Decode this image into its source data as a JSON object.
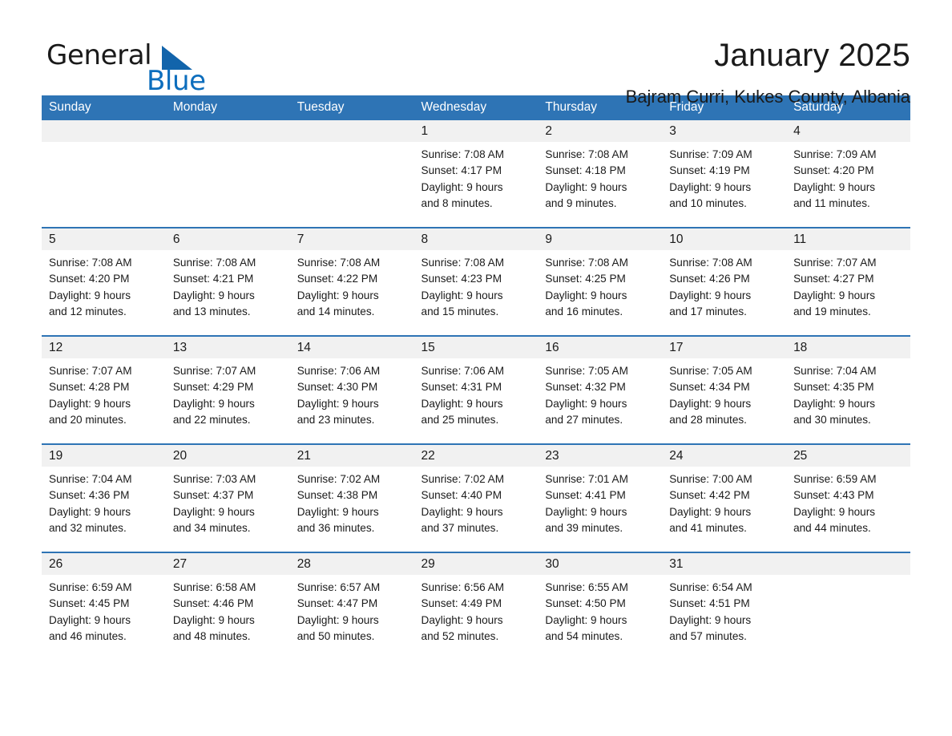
{
  "logo": {
    "word1": "General",
    "word2": "Blue",
    "triangle_color": "#1264ab",
    "word2_color": "#0d6ebd"
  },
  "header": {
    "month_title": "January 2025",
    "location": "Bajram Curri, Kukes County, Albania"
  },
  "theme": {
    "header_blue": "#2e74b5",
    "daynum_band": "#f1f1f1",
    "page_background": "#ffffff",
    "text": "#1a1a1a"
  },
  "calendar": {
    "weekday_headers": [
      "Sunday",
      "Monday",
      "Tuesday",
      "Wednesday",
      "Thursday",
      "Friday",
      "Saturday"
    ],
    "weeks": [
      [
        {
          "day": "",
          "lines": []
        },
        {
          "day": "",
          "lines": []
        },
        {
          "day": "",
          "lines": []
        },
        {
          "day": "1",
          "lines": [
            "Sunrise: 7:08 AM",
            "Sunset: 4:17 PM",
            "Daylight: 9 hours",
            "and 8 minutes."
          ]
        },
        {
          "day": "2",
          "lines": [
            "Sunrise: 7:08 AM",
            "Sunset: 4:18 PM",
            "Daylight: 9 hours",
            "and 9 minutes."
          ]
        },
        {
          "day": "3",
          "lines": [
            "Sunrise: 7:09 AM",
            "Sunset: 4:19 PM",
            "Daylight: 9 hours",
            "and 10 minutes."
          ]
        },
        {
          "day": "4",
          "lines": [
            "Sunrise: 7:09 AM",
            "Sunset: 4:20 PM",
            "Daylight: 9 hours",
            "and 11 minutes."
          ]
        }
      ],
      [
        {
          "day": "5",
          "lines": [
            "Sunrise: 7:08 AM",
            "Sunset: 4:20 PM",
            "Daylight: 9 hours",
            "and 12 minutes."
          ]
        },
        {
          "day": "6",
          "lines": [
            "Sunrise: 7:08 AM",
            "Sunset: 4:21 PM",
            "Daylight: 9 hours",
            "and 13 minutes."
          ]
        },
        {
          "day": "7",
          "lines": [
            "Sunrise: 7:08 AM",
            "Sunset: 4:22 PM",
            "Daylight: 9 hours",
            "and 14 minutes."
          ]
        },
        {
          "day": "8",
          "lines": [
            "Sunrise: 7:08 AM",
            "Sunset: 4:23 PM",
            "Daylight: 9 hours",
            "and 15 minutes."
          ]
        },
        {
          "day": "9",
          "lines": [
            "Sunrise: 7:08 AM",
            "Sunset: 4:25 PM",
            "Daylight: 9 hours",
            "and 16 minutes."
          ]
        },
        {
          "day": "10",
          "lines": [
            "Sunrise: 7:08 AM",
            "Sunset: 4:26 PM",
            "Daylight: 9 hours",
            "and 17 minutes."
          ]
        },
        {
          "day": "11",
          "lines": [
            "Sunrise: 7:07 AM",
            "Sunset: 4:27 PM",
            "Daylight: 9 hours",
            "and 19 minutes."
          ]
        }
      ],
      [
        {
          "day": "12",
          "lines": [
            "Sunrise: 7:07 AM",
            "Sunset: 4:28 PM",
            "Daylight: 9 hours",
            "and 20 minutes."
          ]
        },
        {
          "day": "13",
          "lines": [
            "Sunrise: 7:07 AM",
            "Sunset: 4:29 PM",
            "Daylight: 9 hours",
            "and 22 minutes."
          ]
        },
        {
          "day": "14",
          "lines": [
            "Sunrise: 7:06 AM",
            "Sunset: 4:30 PM",
            "Daylight: 9 hours",
            "and 23 minutes."
          ]
        },
        {
          "day": "15",
          "lines": [
            "Sunrise: 7:06 AM",
            "Sunset: 4:31 PM",
            "Daylight: 9 hours",
            "and 25 minutes."
          ]
        },
        {
          "day": "16",
          "lines": [
            "Sunrise: 7:05 AM",
            "Sunset: 4:32 PM",
            "Daylight: 9 hours",
            "and 27 minutes."
          ]
        },
        {
          "day": "17",
          "lines": [
            "Sunrise: 7:05 AM",
            "Sunset: 4:34 PM",
            "Daylight: 9 hours",
            "and 28 minutes."
          ]
        },
        {
          "day": "18",
          "lines": [
            "Sunrise: 7:04 AM",
            "Sunset: 4:35 PM",
            "Daylight: 9 hours",
            "and 30 minutes."
          ]
        }
      ],
      [
        {
          "day": "19",
          "lines": [
            "Sunrise: 7:04 AM",
            "Sunset: 4:36 PM",
            "Daylight: 9 hours",
            "and 32 minutes."
          ]
        },
        {
          "day": "20",
          "lines": [
            "Sunrise: 7:03 AM",
            "Sunset: 4:37 PM",
            "Daylight: 9 hours",
            "and 34 minutes."
          ]
        },
        {
          "day": "21",
          "lines": [
            "Sunrise: 7:02 AM",
            "Sunset: 4:38 PM",
            "Daylight: 9 hours",
            "and 36 minutes."
          ]
        },
        {
          "day": "22",
          "lines": [
            "Sunrise: 7:02 AM",
            "Sunset: 4:40 PM",
            "Daylight: 9 hours",
            "and 37 minutes."
          ]
        },
        {
          "day": "23",
          "lines": [
            "Sunrise: 7:01 AM",
            "Sunset: 4:41 PM",
            "Daylight: 9 hours",
            "and 39 minutes."
          ]
        },
        {
          "day": "24",
          "lines": [
            "Sunrise: 7:00 AM",
            "Sunset: 4:42 PM",
            "Daylight: 9 hours",
            "and 41 minutes."
          ]
        },
        {
          "day": "25",
          "lines": [
            "Sunrise: 6:59 AM",
            "Sunset: 4:43 PM",
            "Daylight: 9 hours",
            "and 44 minutes."
          ]
        }
      ],
      [
        {
          "day": "26",
          "lines": [
            "Sunrise: 6:59 AM",
            "Sunset: 4:45 PM",
            "Daylight: 9 hours",
            "and 46 minutes."
          ]
        },
        {
          "day": "27",
          "lines": [
            "Sunrise: 6:58 AM",
            "Sunset: 4:46 PM",
            "Daylight: 9 hours",
            "and 48 minutes."
          ]
        },
        {
          "day": "28",
          "lines": [
            "Sunrise: 6:57 AM",
            "Sunset: 4:47 PM",
            "Daylight: 9 hours",
            "and 50 minutes."
          ]
        },
        {
          "day": "29",
          "lines": [
            "Sunrise: 6:56 AM",
            "Sunset: 4:49 PM",
            "Daylight: 9 hours",
            "and 52 minutes."
          ]
        },
        {
          "day": "30",
          "lines": [
            "Sunrise: 6:55 AM",
            "Sunset: 4:50 PM",
            "Daylight: 9 hours",
            "and 54 minutes."
          ]
        },
        {
          "day": "31",
          "lines": [
            "Sunrise: 6:54 AM",
            "Sunset: 4:51 PM",
            "Daylight: 9 hours",
            "and 57 minutes."
          ]
        },
        {
          "day": "",
          "lines": []
        }
      ]
    ]
  }
}
